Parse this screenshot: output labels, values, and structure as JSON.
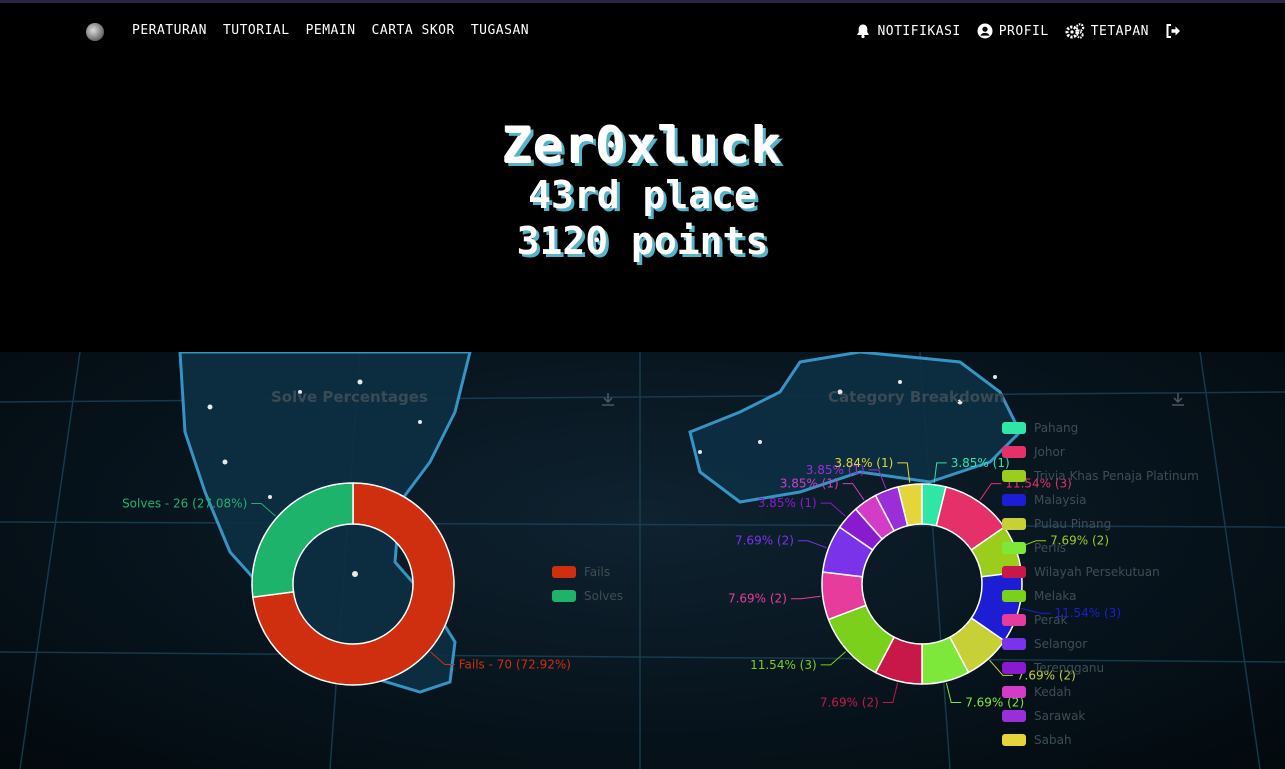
{
  "nav": {
    "left_items": [
      "PERATURAN",
      "TUTORIAL",
      "PEMAIN",
      "CARTA SKOR",
      "TUGASAN"
    ],
    "notifications_label": "NOTIFIKASI",
    "profile_label": "PROFIL",
    "settings_label": "TETAPAN"
  },
  "hero": {
    "name": "Zer0xluck",
    "place": "43rd place",
    "points": "3120 points"
  },
  "chart_data": [
    {
      "type": "pie",
      "title": "Solve Percentages",
      "categories": [
        "Fails",
        "Solves"
      ],
      "values": [
        70,
        26
      ],
      "colors": [
        "#cf2f0e",
        "#1eb36a"
      ],
      "data_labels": [
        "Fails - 70 (72.92%)",
        "Solves - 26 (27.08%)"
      ],
      "legend": "right"
    },
    {
      "type": "pie",
      "title": "Category Breakdown",
      "categories": [
        "Pahang",
        "Johor",
        "Trivia Khas Penaja Platinum",
        "Malaysia",
        "Pulau Pinang",
        "Perlis",
        "Wilayah Persekutuan",
        "Melaka",
        "Perak",
        "Selangor",
        "Terengganu",
        "Kedah",
        "Sarawak",
        "Sabah"
      ],
      "values": [
        1,
        3,
        2,
        3,
        2,
        2,
        2,
        3,
        2,
        2,
        1,
        1,
        1,
        1
      ],
      "colors": [
        "#2ee6a6",
        "#e6306a",
        "#9acd1c",
        "#1d1ed4",
        "#c8d038",
        "#7ee83a",
        "#c8184a",
        "#7ad01a",
        "#e83c9c",
        "#7a33e8",
        "#8a1ad0",
        "#d43cc8",
        "#9a2ed8",
        "#e4d63a"
      ],
      "data_labels": [
        "3.85% (1)",
        "11.54% (3)",
        "7.69% (2)",
        "11.54% (3)",
        "7.69% (2)",
        "7.69% (2)",
        "7.69% (2)",
        "11.54% (3)",
        "7.69% (2)",
        "7.69% (2)",
        "3.85% (1)",
        "3.85% (1)",
        "3.85% (1)",
        "3.84% (1)"
      ],
      "legend": "right"
    }
  ]
}
